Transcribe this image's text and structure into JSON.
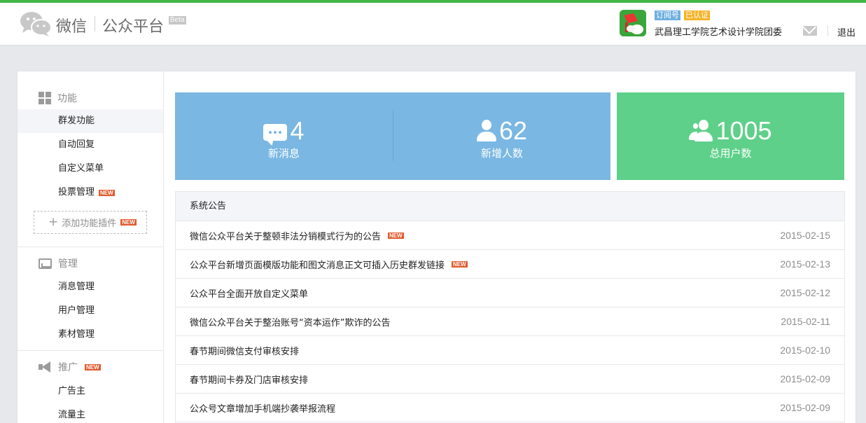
{
  "header": {
    "logo_wechat": "微信",
    "logo_platform": "公众平台",
    "beta": "Beta",
    "account_type": "订阅号",
    "verified": "已认证",
    "account_name": "武昌理工学院艺术设计学院团委",
    "logout": "退出"
  },
  "sidebar": {
    "sections": [
      {
        "title": "功能",
        "icon": "grid-icon"
      },
      {
        "title": "管理",
        "icon": "inbox-icon"
      },
      {
        "title": "推广",
        "icon": "megaphone-icon",
        "badge": "NEW"
      }
    ],
    "function_items": [
      {
        "label": "群发功能",
        "active": true
      },
      {
        "label": "自动回复"
      },
      {
        "label": "自定义菜单"
      },
      {
        "label": "投票管理",
        "badge": "NEW"
      }
    ],
    "add_plugin": "添加功能插件",
    "add_plugin_badge": "NEW",
    "manage_items": [
      {
        "label": "消息管理"
      },
      {
        "label": "用户管理"
      },
      {
        "label": "素材管理"
      }
    ],
    "promo_items": [
      {
        "label": "广告主"
      },
      {
        "label": "流量主"
      }
    ]
  },
  "stats": {
    "new_messages": {
      "value": "4",
      "label": "新消息"
    },
    "new_users": {
      "value": "62",
      "label": "新增人数"
    },
    "total_users": {
      "value": "1005",
      "label": "总用户数"
    }
  },
  "notices": {
    "title": "系统公告",
    "items": [
      {
        "title": "微信公众平台关于整顿非法分销模式行为的公告",
        "badge": "NEW",
        "date": "2015-02-15"
      },
      {
        "title": "公众平台新增页面模版功能和图文消息正文可插入历史群发链接",
        "badge": "NEW",
        "date": "2015-02-13"
      },
      {
        "title": "公众平台全面开放自定义菜单",
        "date": "2015-02-12"
      },
      {
        "title": "微信公众平台关于整治账号“资本运作”欺诈的公告",
        "date": "2015-02-11"
      },
      {
        "title": "春节期间微信支付审核安排",
        "date": "2015-02-10"
      },
      {
        "title": "春节期间卡券及门店审核安排",
        "date": "2015-02-09"
      },
      {
        "title": "公众号文章增加手机端抄袭举报流程",
        "date": "2015-02-09"
      }
    ]
  },
  "colors": {
    "accent_green": "#44b549",
    "stat_blue": "#7ab7e3",
    "stat_green": "#5ed089",
    "new_badge": "#e1582b"
  }
}
